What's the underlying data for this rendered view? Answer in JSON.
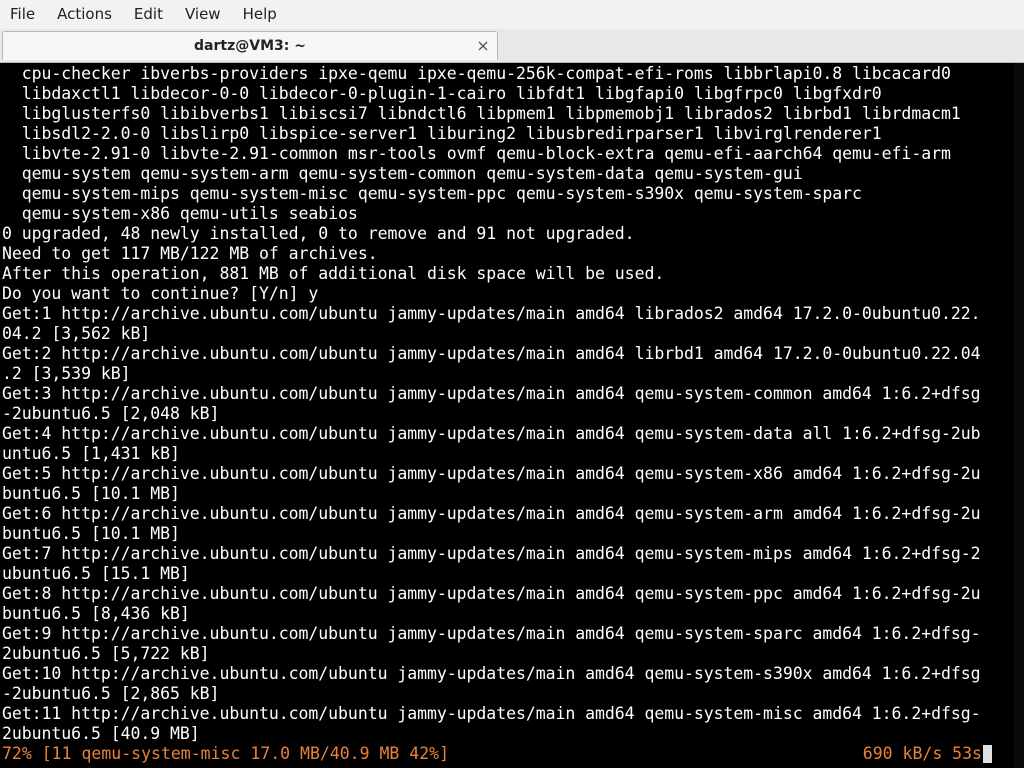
{
  "menubar": {
    "items": [
      "File",
      "Actions",
      "Edit",
      "View",
      "Help"
    ]
  },
  "tab": {
    "title": "dartz@VM3: ~",
    "close_icon": "close-icon"
  },
  "terminal": {
    "lines": [
      "  cpu-checker ibverbs-providers ipxe-qemu ipxe-qemu-256k-compat-efi-roms libbrlapi0.8 libcacard0",
      "  libdaxctl1 libdecor-0-0 libdecor-0-plugin-1-cairo libfdt1 libgfapi0 libgfrpc0 libgfxdr0",
      "  libglusterfs0 libibverbs1 libiscsi7 libndctl6 libpmem1 libpmemobj1 librados2 librbd1 librdmacm1",
      "  libsdl2-2.0-0 libslirp0 libspice-server1 liburing2 libusbredirparser1 libvirglrenderer1",
      "  libvte-2.91-0 libvte-2.91-common msr-tools ovmf qemu-block-extra qemu-efi-aarch64 qemu-efi-arm",
      "  qemu-system qemu-system-arm qemu-system-common qemu-system-data qemu-system-gui",
      "  qemu-system-mips qemu-system-misc qemu-system-ppc qemu-system-s390x qemu-system-sparc",
      "  qemu-system-x86 qemu-utils seabios",
      "0 upgraded, 48 newly installed, 0 to remove and 91 not upgraded.",
      "Need to get 117 MB/122 MB of archives.",
      "After this operation, 881 MB of additional disk space will be used.",
      "Do you want to continue? [Y/n] y",
      "Get:1 http://archive.ubuntu.com/ubuntu jammy-updates/main amd64 librados2 amd64 17.2.0-0ubuntu0.22.",
      "04.2 [3,562 kB]",
      "Get:2 http://archive.ubuntu.com/ubuntu jammy-updates/main amd64 librbd1 amd64 17.2.0-0ubuntu0.22.04",
      ".2 [3,539 kB]",
      "Get:3 http://archive.ubuntu.com/ubuntu jammy-updates/main amd64 qemu-system-common amd64 1:6.2+dfsg",
      "-2ubuntu6.5 [2,048 kB]",
      "Get:4 http://archive.ubuntu.com/ubuntu jammy-updates/main amd64 qemu-system-data all 1:6.2+dfsg-2ub",
      "untu6.5 [1,431 kB]",
      "Get:5 http://archive.ubuntu.com/ubuntu jammy-updates/main amd64 qemu-system-x86 amd64 1:6.2+dfsg-2u",
      "buntu6.5 [10.1 MB]",
      "Get:6 http://archive.ubuntu.com/ubuntu jammy-updates/main amd64 qemu-system-arm amd64 1:6.2+dfsg-2u",
      "buntu6.5 [10.1 MB]",
      "Get:7 http://archive.ubuntu.com/ubuntu jammy-updates/main amd64 qemu-system-mips amd64 1:6.2+dfsg-2",
      "ubuntu6.5 [15.1 MB]",
      "Get:8 http://archive.ubuntu.com/ubuntu jammy-updates/main amd64 qemu-system-ppc amd64 1:6.2+dfsg-2u",
      "buntu6.5 [8,436 kB]",
      "Get:9 http://archive.ubuntu.com/ubuntu jammy-updates/main amd64 qemu-system-sparc amd64 1:6.2+dfsg-",
      "2ubuntu6.5 [5,722 kB]",
      "Get:10 http://archive.ubuntu.com/ubuntu jammy-updates/main amd64 qemu-system-s390x amd64 1:6.2+dfsg",
      "-2ubuntu6.5 [2,865 kB]",
      "Get:11 http://archive.ubuntu.com/ubuntu jammy-updates/main amd64 qemu-system-misc amd64 1:6.2+dfsg-",
      "2ubuntu6.5 [40.9 MB]"
    ],
    "status_left": "72% [11 qemu-system-misc 17.0 MB/40.9 MB 42%]",
    "status_right": "690 kB/s 53s",
    "status_color": "#e8823a",
    "background": "#000000",
    "foreground": "#ffffff"
  }
}
